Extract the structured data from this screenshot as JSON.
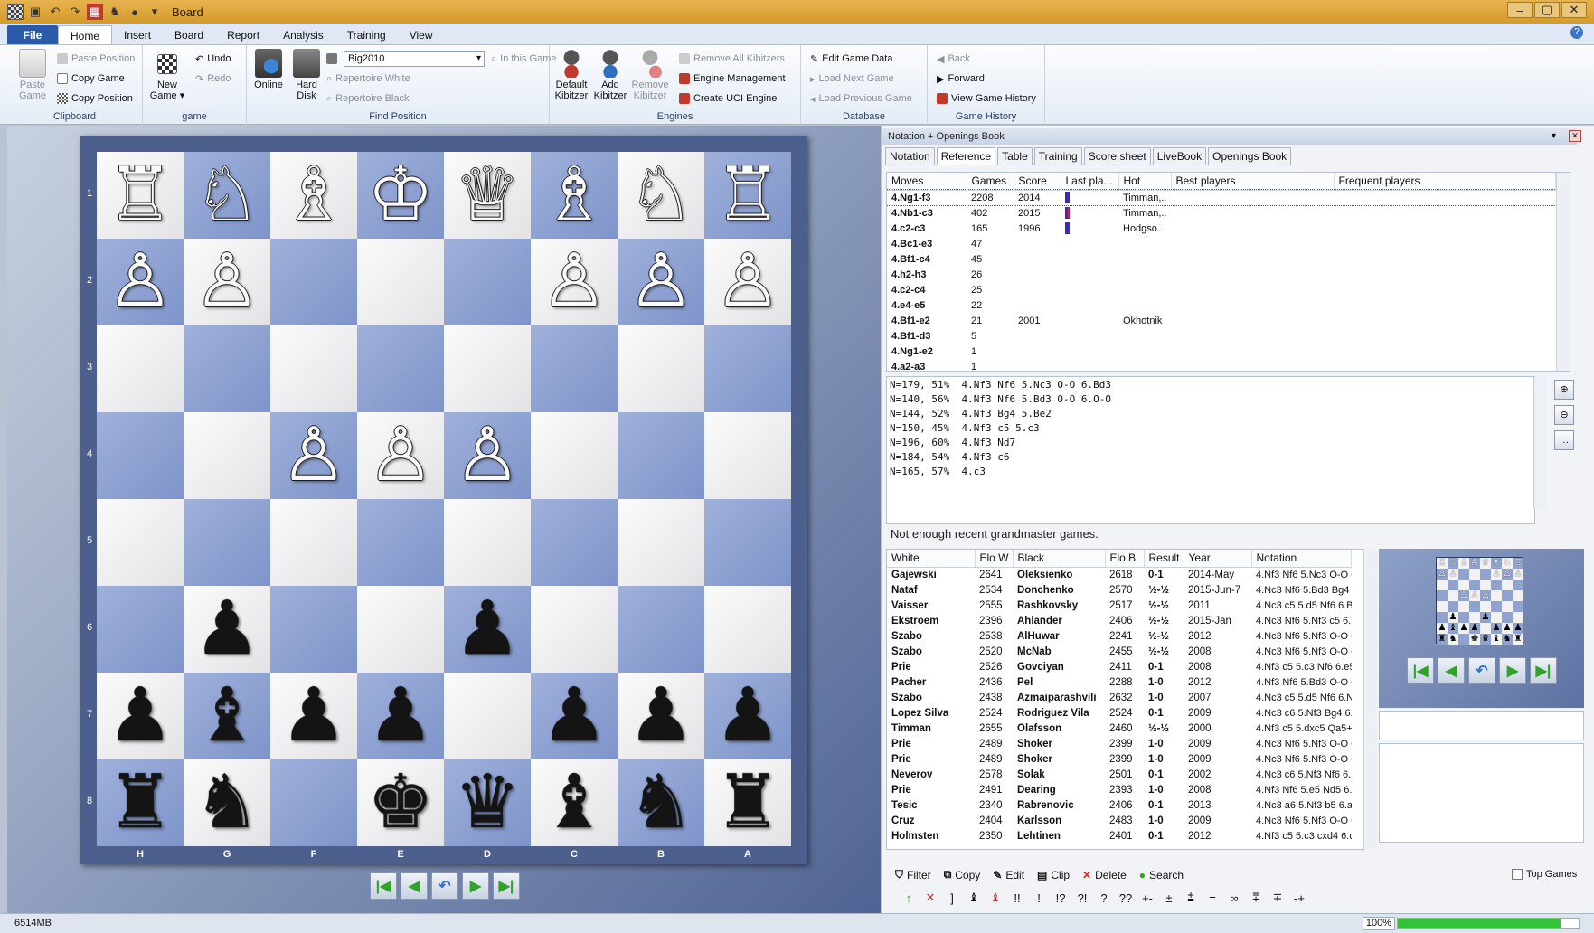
{
  "window": {
    "title": "Board"
  },
  "menu": {
    "file": "File",
    "tabs": [
      "Home",
      "Insert",
      "Board",
      "Report",
      "Analysis",
      "Training",
      "View"
    ]
  },
  "ribbon": {
    "clipboard": {
      "label": "Clipboard",
      "paste_game": "Paste Game",
      "paste_position": "Paste Position",
      "copy_game": "Copy Game",
      "copy_position": "Copy Position"
    },
    "game": {
      "label": "game",
      "new_game": "New Game",
      "undo": "Undo",
      "redo": "Redo"
    },
    "find": {
      "label": "Find Position",
      "online": "Online",
      "hard_disk": "Hard Disk",
      "database": "Big2010",
      "in_this_game": "In this Game",
      "repertoire_white": "Repertoire White",
      "repertoire_black": "Repertoire Black"
    },
    "engines": {
      "label": "Engines",
      "default_kibitzer": "Default Kibitzer",
      "add_kibitzer": "Add Kibitzer",
      "remove_kibitzer": "Remove Kibitzer",
      "remove_all": "Remove All Kibitzers",
      "engine_management": "Engine Management",
      "create_uci": "Create UCI Engine"
    },
    "database": {
      "label": "Database",
      "edit_game_data": "Edit Game Data",
      "load_next": "Load Next Game",
      "load_previous": "Load Previous Game"
    },
    "history": {
      "label": "Game History",
      "back": "Back",
      "forward": "Forward",
      "view_history": "View Game History"
    }
  },
  "board": {
    "ranks": [
      "1",
      "2",
      "3",
      "4",
      "5",
      "6",
      "7",
      "8"
    ],
    "files": [
      "H",
      "G",
      "F",
      "E",
      "D",
      "C",
      "B",
      "A"
    ],
    "rows": [
      [
        "wR",
        "wN",
        "wB",
        "wK",
        "wQ",
        "wB",
        "wN",
        "wR"
      ],
      [
        "wP",
        "wP",
        "",
        "",
        "",
        "wP",
        "wP",
        "wP"
      ],
      [
        "",
        "",
        "",
        "",
        "",
        "",
        "",
        ""
      ],
      [
        "",
        "",
        "wP",
        "wP",
        "wP",
        "",
        "",
        ""
      ],
      [
        "",
        "",
        "",
        "",
        "",
        "",
        "",
        ""
      ],
      [
        "",
        "bP",
        "",
        "",
        "bP",
        "",
        "",
        ""
      ],
      [
        "bP",
        "bB",
        "bP",
        "bP",
        "",
        "bP",
        "bP",
        "bP"
      ],
      [
        "bR",
        "bN",
        "",
        "bK",
        "bQ",
        "bB",
        "bN",
        "bR"
      ]
    ],
    "glyphs": {
      "wK": "♔",
      "wQ": "♕",
      "wR": "♖",
      "wB": "♗",
      "wN": "♘",
      "wP": "♙",
      "bK": "♚",
      "bQ": "♛",
      "bR": "♜",
      "bB": "♝",
      "bN": "♞",
      "bP": "♟"
    }
  },
  "pane": {
    "title": "Notation + Openings Book",
    "tabs": [
      "Notation",
      "Reference",
      "Table",
      "Training",
      "Score sheet",
      "LiveBook",
      "Openings Book"
    ],
    "active_tab": "Reference"
  },
  "reference": {
    "columns": [
      "Moves",
      "Games",
      "Score",
      "Last pla...",
      "Hot",
      "Best players",
      "Frequent players"
    ],
    "rows": [
      {
        "move": "4.Ng1-f3",
        "games": "2208",
        "score": "2014",
        "bar": "blue",
        "hot": "Timman,.."
      },
      {
        "move": "4.Nb1-c3",
        "games": "402",
        "score": "2015",
        "bar": "red",
        "hot": "Timman,.."
      },
      {
        "move": "4.c2-c3",
        "games": "165",
        "score": "1996",
        "bar": "blue",
        "hot": "Hodgso.."
      },
      {
        "move": "4.Bc1-e3",
        "games": "47",
        "score": "",
        "bar": "",
        "hot": ""
      },
      {
        "move": "4.Bf1-c4",
        "games": "45",
        "score": "",
        "bar": "",
        "hot": ""
      },
      {
        "move": "4.h2-h3",
        "games": "26",
        "score": "",
        "bar": "",
        "hot": ""
      },
      {
        "move": "4.c2-c4",
        "games": "25",
        "score": "",
        "bar": "",
        "hot": ""
      },
      {
        "move": "4.e4-e5",
        "games": "22",
        "score": "",
        "bar": "",
        "hot": ""
      },
      {
        "move": "4.Bf1-e2",
        "games": "21",
        "score": "2001",
        "bar": "",
        "hot": "Okhotnik"
      },
      {
        "move": "4.Bf1-d3",
        "games": "5",
        "score": "",
        "bar": "",
        "hot": ""
      },
      {
        "move": "4.Ng1-e2",
        "games": "1",
        "score": "",
        "bar": "",
        "hot": ""
      },
      {
        "move": "4.a2-a3",
        "games": "1",
        "score": "",
        "bar": "",
        "hot": ""
      }
    ]
  },
  "lines": [
    "N=179, 51%  4.Nf3 Nf6 5.Nc3 O-O 6.Bd3",
    "N=140, 56%  4.Nf3 Nf6 5.Bd3 O-O 6.O-O",
    "N=144, 52%  4.Nf3 Bg4 5.Be2",
    "N=150, 45%  4.Nf3 c5 5.c3",
    "N=196, 60%  4.Nf3 Nd7",
    "N=184, 54%  4.Nf3 c6",
    "N=165, 57%  4.c3"
  ],
  "status_message": "Not enough recent grandmaster games.",
  "games": {
    "columns": [
      "White",
      "Elo W",
      "Black",
      "Elo B",
      "Result",
      "Year",
      "Notation"
    ],
    "rows": [
      [
        "Gajewski",
        "2641",
        "Oleksienko",
        "2618",
        "0-1",
        "2014-May",
        "4.Nf3 Nf6 5.Nc3 O-O 6"
      ],
      [
        "Nataf",
        "2534",
        "Donchenko",
        "2570",
        "½-½",
        "2015-Jun-7",
        "4.Nc3 Nf6 5.Bd3 Bg4 6"
      ],
      [
        "Vaisser",
        "2555",
        "Rashkovsky",
        "2517",
        "½-½",
        "2011",
        "4.Nc3 c5 5.d5 Nf6 6.Bl"
      ],
      [
        "Ekstroem",
        "2396",
        "Ahlander",
        "2406",
        "½-½",
        "2015-Jan",
        "4.Nc3 Nf6 5.Nf3 c5 6."
      ],
      [
        "Szabo",
        "2538",
        "AlHuwar",
        "2241",
        "½-½",
        "2012",
        "4.Nc3 Nf6 5.Nf3 O-O 6"
      ],
      [
        "Szabo",
        "2520",
        "McNab",
        "2455",
        "½-½",
        "2008",
        "4.Nc3 Nf6 5.Nf3 O-O 6"
      ],
      [
        "Prie",
        "2526",
        "Govciyan",
        "2411",
        "0-1",
        "2008",
        "4.Nf3 c5 5.c3 Nf6 6.e5"
      ],
      [
        "Pacher",
        "2436",
        "Pel",
        "2288",
        "1-0",
        "2012",
        "4.Nf3 Nf6 5.Bd3 O-O 6"
      ],
      [
        "Szabo",
        "2438",
        "Azmaiparashvili",
        "2632",
        "1-0",
        "2007",
        "4.Nc3 c5 5.d5 Nf6 6.N"
      ],
      [
        "Lopez Silva",
        "2524",
        "Rodriguez Vila",
        "2524",
        "0-1",
        "2009",
        "4.Nc3 c6 5.Nf3 Bg4 6."
      ],
      [
        "Timman",
        "2655",
        "Olafsson",
        "2460",
        "½-½",
        "2000",
        "4.Nf3 c5 5.dxc5 Qa5+"
      ],
      [
        "Prie",
        "2489",
        "Shoker",
        "2399",
        "1-0",
        "2009",
        "4.Nc3 Nf6 5.Nf3 O-O 6"
      ],
      [
        "Prie",
        "2489",
        "Shoker",
        "2399",
        "1-0",
        "2009",
        "4.Nc3 Nf6 5.Nf3 O-O 6"
      ],
      [
        "Neverov",
        "2578",
        "Solak",
        "2501",
        "0-1",
        "2002",
        "4.Nc3 c6 5.Nf3 Nf6 6.N"
      ],
      [
        "Prie",
        "2491",
        "Dearing",
        "2393",
        "1-0",
        "2008",
        "4.Nf3 Nf6 5.e5 Nd5 6."
      ],
      [
        "Tesic",
        "2340",
        "Rabrenovic",
        "2406",
        "0-1",
        "2013",
        "4.Nc3 a6 5.Nf3 b5 6.a"
      ],
      [
        "Cruz",
        "2404",
        "Karlsson",
        "2483",
        "1-0",
        "2009",
        "4.Nc3 Nf6 5.Nf3 O-O 6"
      ],
      [
        "Holmsten",
        "2350",
        "Lehtinen",
        "2401",
        "0-1",
        "2012",
        "4.Nf3 c5 5.c3 cxd4 6.c"
      ]
    ]
  },
  "toolbar": {
    "filter": "Filter",
    "copy": "Copy",
    "edit": "Edit",
    "clip": "Clip",
    "delete": "Delete",
    "search": "Search",
    "top_games": "Top Games"
  },
  "annotations": [
    "↑",
    "✕",
    "]",
    "♝",
    "♝",
    "!!",
    "!",
    "!?",
    "?!",
    "?",
    "??",
    "+-",
    "±",
    "⩲",
    "=",
    "∞",
    "⩱",
    "∓",
    "-+"
  ],
  "status": {
    "memory": "6514MB",
    "zoom": "100%",
    "progress": 0.9
  }
}
